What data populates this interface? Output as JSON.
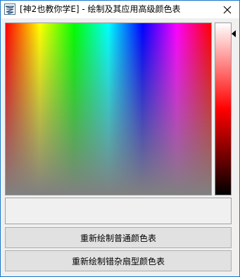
{
  "window": {
    "title": "[神2也教你学E] - 绘制及其应用高级颜色表",
    "icon": "app-logo-icon",
    "close_icon": "close-icon",
    "accent_color": "#1979ca"
  },
  "palette": {
    "hues": [
      "#ff0000",
      "#ffff00",
      "#00ff00",
      "#00ffff",
      "#0000ff",
      "#ff00ff",
      "#ff0000"
    ],
    "fade_to": "#808080"
  },
  "luminance_bar": {
    "colors": [
      "#ffffff",
      "#ff0000",
      "#000000"
    ],
    "pointer_icon": "triangle-left-icon"
  },
  "buttons": {
    "draw_normal_label": "重新绘制普通颜色表",
    "draw_fan_label": "重新绘制错杂扇型颜色表"
  }
}
